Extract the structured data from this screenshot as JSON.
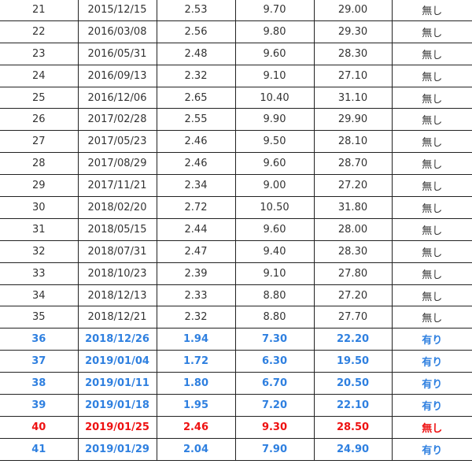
{
  "colors": {
    "normal_text": "#333333",
    "blue_highlight": "#2f80e0",
    "red_highlight": "#ee1111",
    "border": "#222222"
  },
  "rows": [
    {
      "no": "21",
      "date": "2015/12/15",
      "v1": "2.53",
      "v2": "9.70",
      "v3": "29.00",
      "flag": "無し",
      "style": "normal"
    },
    {
      "no": "22",
      "date": "2016/03/08",
      "v1": "2.56",
      "v2": "9.80",
      "v3": "29.30",
      "flag": "無し",
      "style": "normal"
    },
    {
      "no": "23",
      "date": "2016/05/31",
      "v1": "2.48",
      "v2": "9.60",
      "v3": "28.30",
      "flag": "無し",
      "style": "normal"
    },
    {
      "no": "24",
      "date": "2016/09/13",
      "v1": "2.32",
      "v2": "9.10",
      "v3": "27.10",
      "flag": "無し",
      "style": "normal"
    },
    {
      "no": "25",
      "date": "2016/12/06",
      "v1": "2.65",
      "v2": "10.40",
      "v3": "31.10",
      "flag": "無し",
      "style": "normal"
    },
    {
      "no": "26",
      "date": "2017/02/28",
      "v1": "2.55",
      "v2": "9.90",
      "v3": "29.90",
      "flag": "無し",
      "style": "normal"
    },
    {
      "no": "27",
      "date": "2017/05/23",
      "v1": "2.46",
      "v2": "9.50",
      "v3": "28.10",
      "flag": "無し",
      "style": "normal"
    },
    {
      "no": "28",
      "date": "2017/08/29",
      "v1": "2.46",
      "v2": "9.60",
      "v3": "28.70",
      "flag": "無し",
      "style": "normal"
    },
    {
      "no": "29",
      "date": "2017/11/21",
      "v1": "2.34",
      "v2": "9.00",
      "v3": "27.20",
      "flag": "無し",
      "style": "normal"
    },
    {
      "no": "30",
      "date": "2018/02/20",
      "v1": "2.72",
      "v2": "10.50",
      "v3": "31.80",
      "flag": "無し",
      "style": "normal"
    },
    {
      "no": "31",
      "date": "2018/05/15",
      "v1": "2.44",
      "v2": "9.60",
      "v3": "28.00",
      "flag": "無し",
      "style": "normal"
    },
    {
      "no": "32",
      "date": "2018/07/31",
      "v1": "2.47",
      "v2": "9.40",
      "v3": "28.30",
      "flag": "無し",
      "style": "normal"
    },
    {
      "no": "33",
      "date": "2018/10/23",
      "v1": "2.39",
      "v2": "9.10",
      "v3": "27.80",
      "flag": "無し",
      "style": "normal"
    },
    {
      "no": "34",
      "date": "2018/12/13",
      "v1": "2.33",
      "v2": "8.80",
      "v3": "27.20",
      "flag": "無し",
      "style": "normal"
    },
    {
      "no": "35",
      "date": "2018/12/21",
      "v1": "2.32",
      "v2": "8.80",
      "v3": "27.70",
      "flag": "無し",
      "style": "normal"
    },
    {
      "no": "36",
      "date": "2018/12/26",
      "v1": "1.94",
      "v2": "7.30",
      "v3": "22.20",
      "flag": "有り",
      "style": "blue"
    },
    {
      "no": "37",
      "date": "2019/01/04",
      "v1": "1.72",
      "v2": "6.30",
      "v3": "19.50",
      "flag": "有り",
      "style": "blue"
    },
    {
      "no": "38",
      "date": "2019/01/11",
      "v1": "1.80",
      "v2": "6.70",
      "v3": "20.50",
      "flag": "有り",
      "style": "blue"
    },
    {
      "no": "39",
      "date": "2019/01/18",
      "v1": "1.95",
      "v2": "7.20",
      "v3": "22.10",
      "flag": "有り",
      "style": "blue"
    },
    {
      "no": "40",
      "date": "2019/01/25",
      "v1": "2.46",
      "v2": "9.30",
      "v3": "28.50",
      "flag": "無し",
      "style": "red"
    },
    {
      "no": "41",
      "date": "2019/01/29",
      "v1": "2.04",
      "v2": "7.90",
      "v3": "24.90",
      "flag": "有り",
      "style": "blue"
    }
  ]
}
